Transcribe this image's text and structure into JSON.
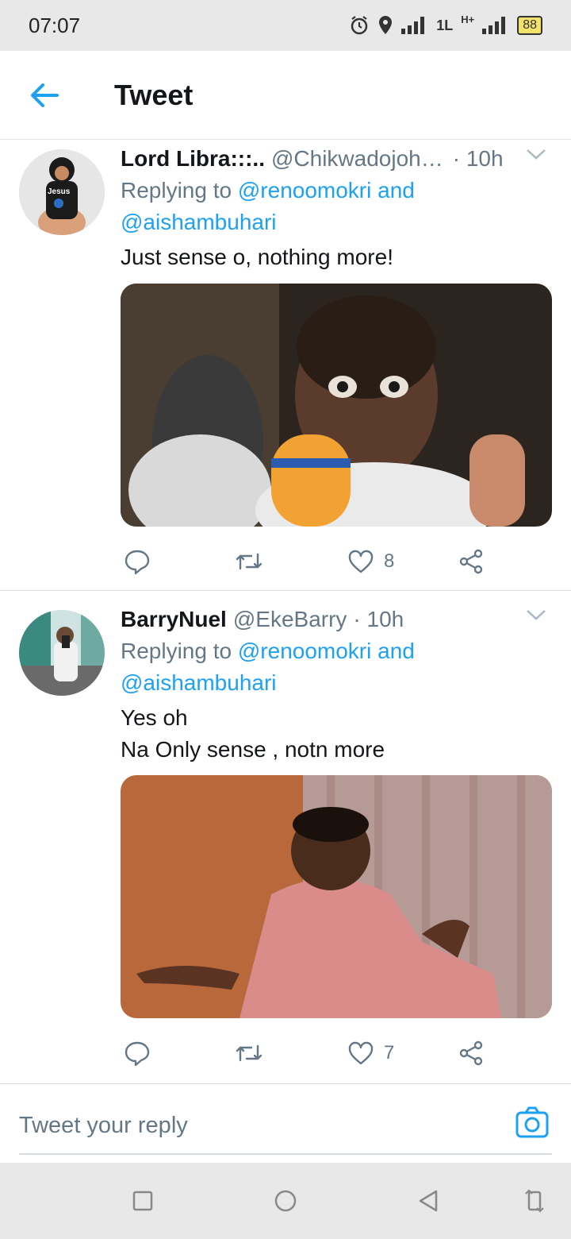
{
  "status": {
    "time": "07:07",
    "battery": "88",
    "net1": "1L",
    "net2": "H+"
  },
  "header": {
    "title": "Tweet"
  },
  "tweets": [
    {
      "name": "Lord Libra:::..",
      "handle": "@Chikwadojoh…",
      "time": "· 10h",
      "replying_prefix": "Replying to",
      "mention1": "@renoomokri and",
      "mention2": "@aishambuhari",
      "text_lines": [
        "Just sense o, nothing more!"
      ],
      "likes": "8",
      "avatar_text": "Jesus"
    },
    {
      "name": "BarryNuel",
      "handle": "@EkeBarry",
      "time": "· 10h",
      "replying_prefix": "Replying to",
      "mention1": "@renoomokri and",
      "mention2": "@aishambuhari",
      "text_lines": [
        "Yes oh",
        "Na Only sense , notn more"
      ],
      "likes": "7"
    }
  ],
  "composer": {
    "placeholder": "Tweet your reply"
  },
  "colors": {
    "accent": "#1da1f2",
    "secondary": "#657786",
    "text": "#14171a"
  },
  "icons": [
    "back-arrow-icon",
    "reply-icon",
    "retweet-icon",
    "like-icon",
    "share-icon",
    "camera-icon",
    "chevron-down-icon"
  ]
}
